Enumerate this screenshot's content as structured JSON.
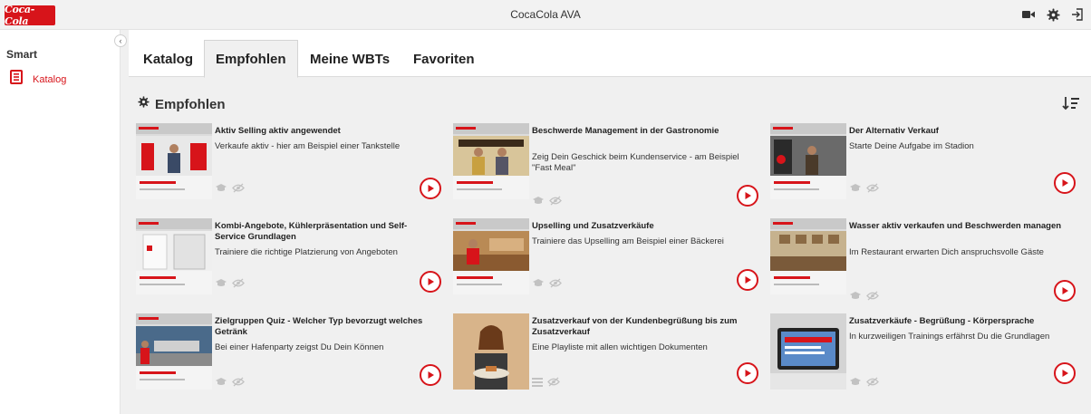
{
  "app": {
    "title": "CocaCola AVA",
    "logo_text": "Coca-Cola",
    "brand_color": "#d7141a"
  },
  "topbar_icons": [
    "video-camera-icon",
    "gear-icon",
    "logout-icon"
  ],
  "sidebar": {
    "heading": "Smart",
    "items": [
      {
        "label": "Katalog",
        "icon": "book-icon",
        "active": true
      }
    ]
  },
  "tabs": [
    {
      "label": "Katalog",
      "active": false
    },
    {
      "label": "Empfohlen",
      "active": true
    },
    {
      "label": "Meine WBTs",
      "active": false
    },
    {
      "label": "Favoriten",
      "active": false
    }
  ],
  "section": {
    "title": "Empfohlen",
    "icon": "gear-icon",
    "sort_icon": "sort-icon"
  },
  "cards": [
    {
      "title": "Aktiv Selling aktiv angewendet",
      "desc": "Verkaufe aktiv - hier am Beispiel einer Tankstelle",
      "status_icons": [
        "graduation-cap-icon",
        "eye-slash-icon"
      ]
    },
    {
      "title": "Beschwerde Management in der Gastronomie",
      "desc": "Zeig Dein Geschick beim Kundenservice - am Beispiel \"Fast Meal\"",
      "status_icons": [
        "graduation-cap-icon",
        "eye-slash-icon"
      ]
    },
    {
      "title": "Der Alternativ Verkauf",
      "desc": "Starte Deine Aufgabe im Stadion",
      "status_icons": [
        "graduation-cap-icon",
        "eye-slash-icon"
      ]
    },
    {
      "title": "Kombi-Angebote, Kühlerpräsentation und Self-Service Grundlagen",
      "desc": "Trainiere die richtige Platzierung von Angeboten",
      "status_icons": [
        "graduation-cap-icon",
        "eye-slash-icon"
      ]
    },
    {
      "title": "Upselling und Zusatzverkäufe",
      "desc": "Trainiere das Upselling am Beispiel einer Bäckerei",
      "status_icons": [
        "graduation-cap-icon",
        "eye-slash-icon"
      ]
    },
    {
      "title": "Wasser aktiv verkaufen und Beschwerden managen",
      "desc": "Im Restaurant erwarten Dich anspruchsvolle Gäste",
      "status_icons": [
        "graduation-cap-icon",
        "eye-slash-icon"
      ]
    },
    {
      "title": "Zielgruppen Quiz - Welcher Typ bevorzugt welches Getränk",
      "desc": "Bei einer Hafenparty zeigst Du Dein Können",
      "status_icons": [
        "graduation-cap-icon",
        "eye-slash-icon"
      ]
    },
    {
      "title": "Zusatzverkauf von der Kundenbegrüßung bis zum Zusatzverkauf",
      "desc": "Eine Playliste mit allen wichtigen Dokumenten",
      "status_icons": [
        "list-icon",
        "eye-slash-icon"
      ]
    },
    {
      "title": "Zusatzverkäufe - Begrüßung - Körpersprache",
      "desc": "In kurzweiligen Trainings erfährst Du die Grundlagen",
      "status_icons": [
        "graduation-cap-icon",
        "eye-slash-icon"
      ]
    }
  ]
}
